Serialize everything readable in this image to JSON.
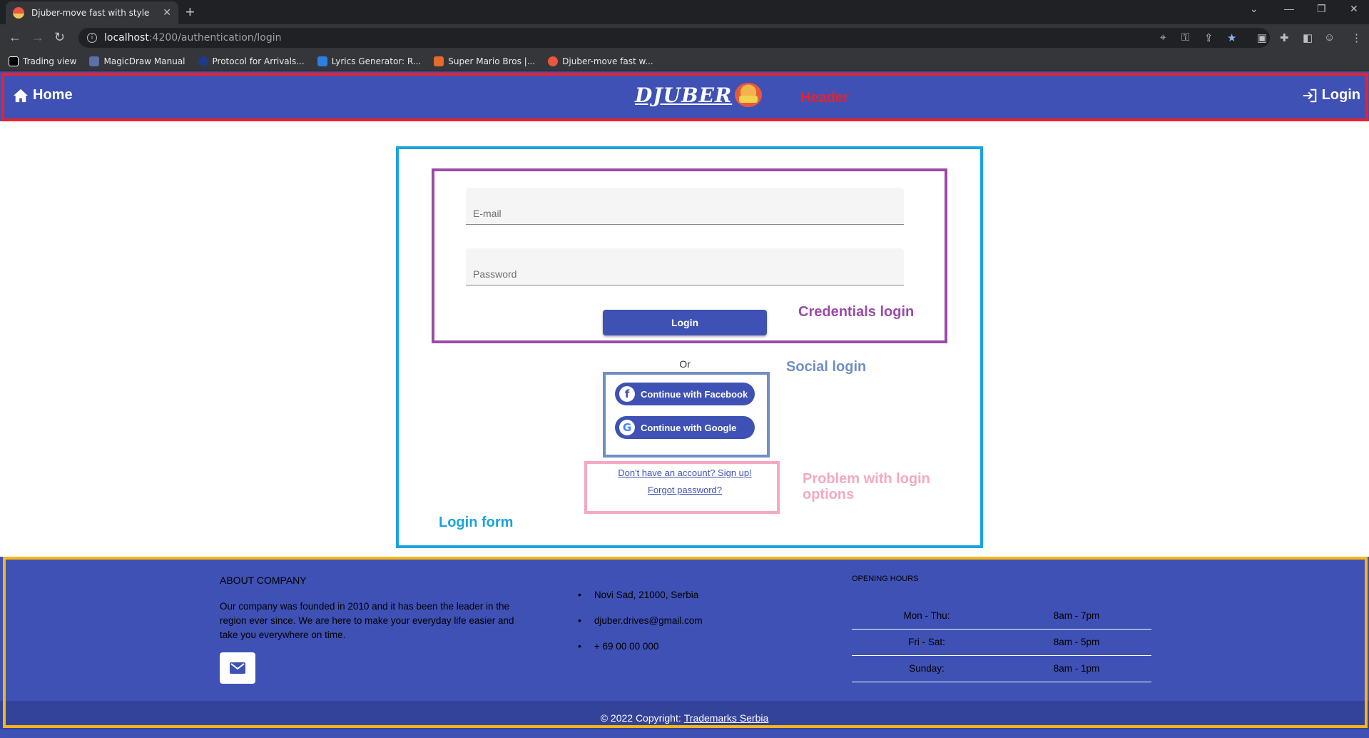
{
  "browser": {
    "tab_title": "Djuber-move fast with style",
    "tab_close": "✕",
    "new_tab": "+",
    "url_host": "localhost",
    "url_path": ":4200/authentication/login",
    "bookmarks": [
      {
        "label": "Trading view",
        "icon_color": "#ffffff"
      },
      {
        "label": "MagicDraw Manual",
        "icon_color": "#5b6fa8"
      },
      {
        "label": "Protocol for Arrivals...",
        "icon_color": "#1e3a8a"
      },
      {
        "label": "Lyrics Generator: R...",
        "icon_color": "#2b7fe0"
      },
      {
        "label": "Super Mario Bros |...",
        "icon_color": "#e36b2c"
      },
      {
        "label": "Djuber-move fast w...",
        "icon_color": "#e9573f"
      }
    ]
  },
  "header": {
    "home_label": "Home",
    "logo_text": "DJUBER",
    "login_label": "Login",
    "annotation": "Header",
    "bg_color": "#3f51b5"
  },
  "login_form": {
    "email_placeholder": "E-mail",
    "password_placeholder": "Password",
    "login_button": "Login",
    "or_text": "Or",
    "facebook_button": "Continue with Facebook",
    "google_button": "Continue with Google",
    "signup_link": "Don't have an account? Sign up!",
    "forgot_link": "Forgot password?"
  },
  "annotations": {
    "credentials": "Credentials login",
    "social": "Social login",
    "problem_line1": "Problem with login",
    "problem_line2": "options",
    "login_form": "Login form",
    "colors": {
      "header": "#e8222d",
      "login_form": "#1aa3e0",
      "credentials": "#9b4aa8",
      "social": "#6f8fc4",
      "problem": "#f4a8c3",
      "footer": "#f5b51b"
    }
  },
  "footer": {
    "about_title": "ABOUT COMPANY",
    "about_text": "Our company was founded in 2010 and it has been the leader in the region ever since. We are here to make your everyday life easier and take you everywhere on time.",
    "contacts": [
      "Novi Sad, 21000, Serbia",
      "djuber.drives@gmail.com",
      "+ 69 00 00 000"
    ],
    "hours_title": "OPENING HOURS",
    "hours": [
      {
        "day": "Mon - Thu:",
        "time": "8am - 7pm"
      },
      {
        "day": "Fri - Sat:",
        "time": "8am - 5pm"
      },
      {
        "day": "Sunday:",
        "time": "8am - 1pm"
      }
    ],
    "copyright_prefix": "© 2022 Copyright:",
    "copyright_link": "Trademarks Serbia"
  }
}
